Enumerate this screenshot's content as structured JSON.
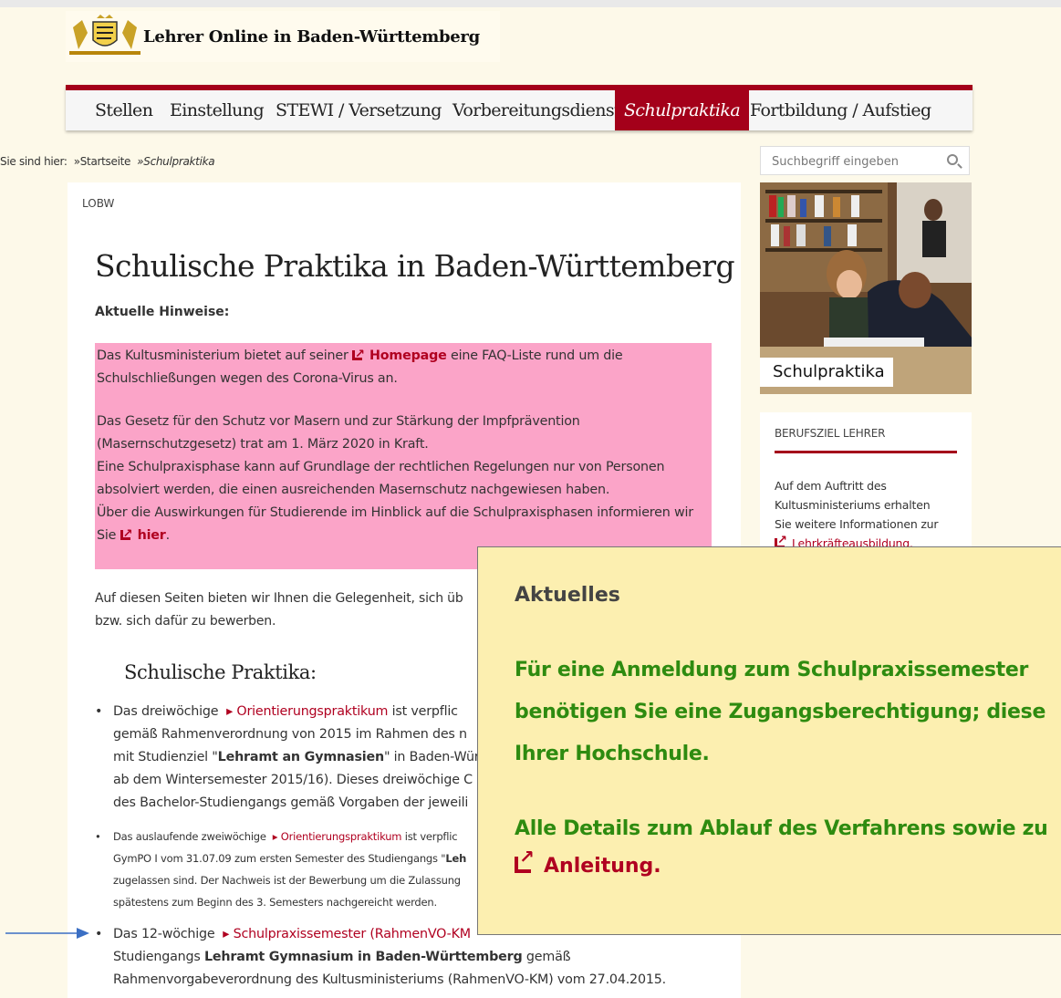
{
  "header": {
    "site_title": "Lehrer Online in Baden-Württemberg"
  },
  "nav": {
    "items": [
      {
        "label": "Stellen"
      },
      {
        "label": "Einstellung"
      },
      {
        "label": "STEWI / Versetzung"
      },
      {
        "label": "Vorbereitungsdienst"
      },
      {
        "label": "Schulpraktika",
        "active": true
      },
      {
        "label": "Fortbildung / Aufstieg"
      }
    ]
  },
  "breadcrumb": {
    "prefix": "Sie sind hier:",
    "home": "»Startseite",
    "current": "»Schulpraktika"
  },
  "search": {
    "placeholder": "Suchbegriff eingeben",
    "icon": "search-icon"
  },
  "main": {
    "section_label": "LOBW",
    "title": "Schulische Praktika in Baden-Württemberg",
    "notice_heading": "Aktuelle Hinweise:",
    "notice": {
      "p1_before": "Das Kultusministerium bietet auf seiner",
      "p1_link": "Homepage",
      "p1_after": " eine FAQ-Liste rund um die",
      "p1_line2": "Schulschließungen wegen des Corona-Virus an.",
      "p2_line1": "Das Gesetz für den Schutz vor Masern und zur Stärkung der Impfprävention",
      "p2_line2": "(Masernschutzgesetz) trat am 1. März 2020 in Kraft.",
      "p2_line3": "Eine Schulpraxisphase kann auf Grundlage der rechtlichen Regelungen nur von Personen",
      "p2_line4": "absolviert werden, die einen ausreichenden Masernschutz nachgewiesen haben.",
      "p2_line5": "Über die Auswirkungen für Studierende im Hinblick auf die Schulpraxisphasen informieren wir",
      "p2_line6_before": "Sie",
      "p2_line6_link": "hier",
      "p2_line6_after": "."
    },
    "intro_line1": "Auf diesen Seiten bieten wir Ihnen die Gelegenheit, sich üb",
    "intro_line2": "bzw. sich dafür zu bewerben.",
    "subheading": "Schulische Praktika:",
    "list1": {
      "before": "Das dreiwöchige",
      "link": "Orientierungspraktikum",
      "after": " ist verpflic",
      "line2": "gemäß Rahmenverordnung von 2015 im Rahmen des n",
      "line3_before": "mit Studienziel \"",
      "line3_bold": "Lehramt an Gymnasien",
      "line3_after": "\" in Baden-Würt",
      "line4": "ab dem Wintersemester 2015/16). Dieses dreiwöchige C",
      "line5": "des Bachelor-Studiengangs gemäß Vorgaben der jeweili"
    },
    "list2": {
      "before": "Das auslaufende zweiwöchige",
      "link": "Orientierungspraktikum",
      "after": " ist verpflic",
      "line2_before": "GymPO I vom 31.07.09 zum ersten Semester des Studiengangs \"",
      "line2_bold": "Leh",
      "line3": "zugelassen sind. Der Nachweis ist der Bewerbung um die Zulassung",
      "line4": "spätestens zum Beginn des 3. Semesters nachgereicht werden."
    },
    "list3": {
      "before": "Das 12-wöchige",
      "link": "Schulpraxissemester (RahmenVO-KM",
      "line2_before": "Studiengangs ",
      "line2_bold": "Lehramt Gymnasium in Baden-Württemberg",
      "line2_after": " gemäß",
      "line3": "Rahmenvorgabeverordnung des Kultusministeriums (RahmenVO-KM) vom 27.04.2015."
    }
  },
  "sidebar": {
    "image_caption": "Schulpraktika",
    "box_title": "BERUFSZIEL LEHRER",
    "box_line1": "Auf dem Auftritt des",
    "box_line2": "Kultusministeriums erhalten",
    "box_line3": "Sie weitere Informationen zur",
    "box_link": "Lehrkräfteausbildung."
  },
  "popup": {
    "title": "Aktuelles",
    "line1": "Für eine Anmeldung zum Schulpraxissemester",
    "line2": "benötigen Sie eine Zugangsberechtigung; diese",
    "line3": "Ihrer Hochschule.",
    "line4": "Alle Details zum Ablauf des Verfahrens sowie zu",
    "link": "Anleitung",
    "link_after": "."
  },
  "colors": {
    "brand_red": "#a4001a",
    "notice_pink": "#fba4c8",
    "popup_bg": "#fcefb0",
    "popup_green": "#2e8b10",
    "arrow_blue": "#3b6fc4"
  }
}
